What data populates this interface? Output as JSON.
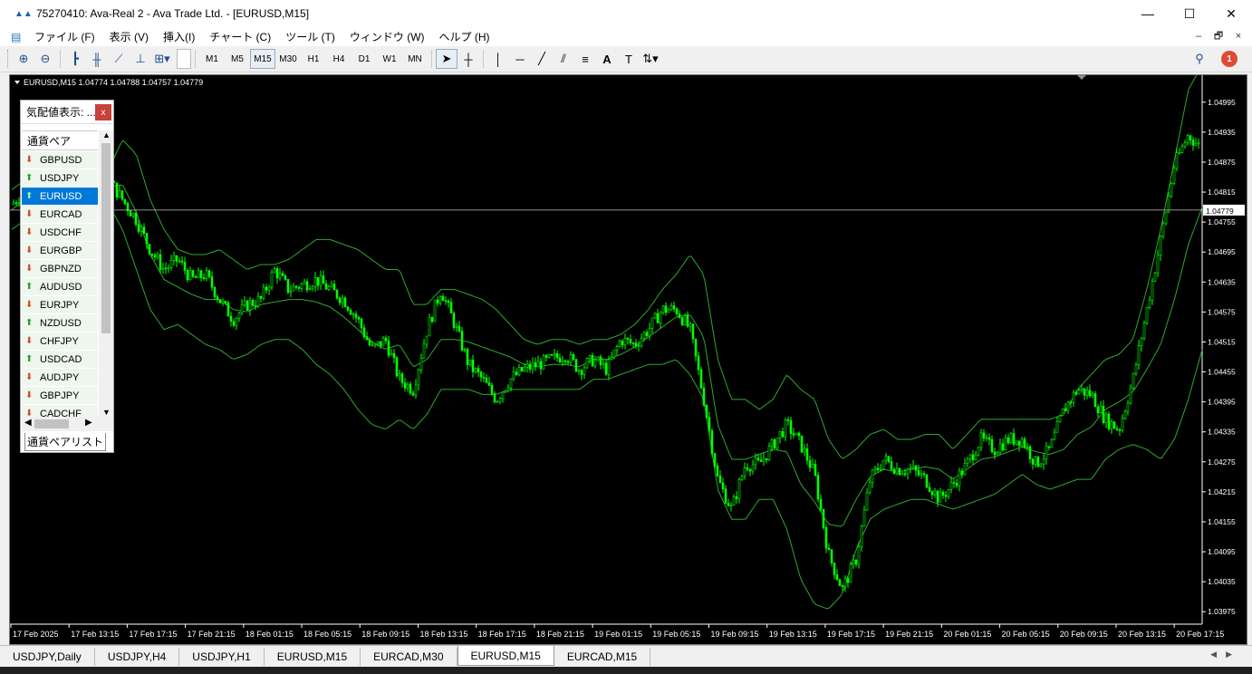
{
  "window": {
    "title": "75270410: Ava-Real 2 - Ava Trade Ltd. - [EURUSD,M15]",
    "minimize": "—",
    "maximize": "☐",
    "close": "✕"
  },
  "menu": [
    "ファイル (F)",
    "表示 (V)",
    "挿入(I)",
    "チャート (C)",
    "ツール (T)",
    "ウィンドウ (W)",
    "ヘルプ (H)"
  ],
  "mdi": {
    "minimize": "–",
    "restore": "🗗",
    "close": "×"
  },
  "timeframes": [
    "M1",
    "M5",
    "M15",
    "M30",
    "H1",
    "H4",
    "D1",
    "W1",
    "MN"
  ],
  "active_timeframe": "M15",
  "notification_count": "1",
  "market_watch": {
    "title": "気配値表示: ...",
    "close": "x",
    "column": "通貨ペア",
    "selected": "EURUSD",
    "rows": [
      {
        "symbol": "GBPUSD",
        "dir": "down"
      },
      {
        "symbol": "USDJPY",
        "dir": "up"
      },
      {
        "symbol": "EURUSD",
        "dir": "up"
      },
      {
        "symbol": "EURCAD",
        "dir": "down"
      },
      {
        "symbol": "USDCHF",
        "dir": "down"
      },
      {
        "symbol": "EURGBP",
        "dir": "down"
      },
      {
        "symbol": "GBPNZD",
        "dir": "down"
      },
      {
        "symbol": "AUDUSD",
        "dir": "up"
      },
      {
        "symbol": "EURJPY",
        "dir": "down"
      },
      {
        "symbol": "NZDUSD",
        "dir": "up"
      },
      {
        "symbol": "CHFJPY",
        "dir": "down"
      },
      {
        "symbol": "USDCAD",
        "dir": "up"
      },
      {
        "symbol": "AUDJPY",
        "dir": "down"
      },
      {
        "symbol": "GBPJPY",
        "dir": "down"
      },
      {
        "symbol": "CADCHF",
        "dir": "down"
      }
    ],
    "tab": "通貨ペアリスト"
  },
  "chart_tabs": [
    "USDJPY,Daily",
    "USDJPY,H4",
    "USDJPY,H1",
    "EURUSD,M15",
    "EURCAD,M30",
    "EURUSD,M15",
    "EURCAD,M15"
  ],
  "active_chart_tab": 5,
  "colors": {
    "candle": "#00ff00",
    "band": "#2fa82f",
    "bg": "#000000",
    "axis": "#ffffff",
    "price_line": "#c0c0c0"
  },
  "chart_data": {
    "type": "candlestick",
    "title": "EURUSD,M15  1.04774 1.04788 1.04757 1.04779",
    "current_price": "1.04779",
    "ylim": [
      1.0395,
      1.0504
    ],
    "y_ticks": [
      "1.04995",
      "1.04935",
      "1.04875",
      "1.04815",
      "1.04755",
      "1.04695",
      "1.04635",
      "1.04575",
      "1.04515",
      "1.04455",
      "1.04395",
      "1.04335",
      "1.04275",
      "1.04215",
      "1.04155",
      "1.04095",
      "1.04035",
      "1.03975"
    ],
    "x_ticks": [
      "17 Feb 2025",
      "17 Feb 13:15",
      "17 Feb 17:15",
      "17 Feb 21:15",
      "18 Feb 01:15",
      "18 Feb 05:15",
      "18 Feb 09:15",
      "18 Feb 13:15",
      "18 Feb 17:15",
      "18 Feb 21:15",
      "19 Feb 01:15",
      "19 Feb 05:15",
      "19 Feb 09:15",
      "19 Feb 13:15",
      "19 Feb 17:15",
      "19 Feb 21:15",
      "20 Feb 01:15",
      "20 Feb 05:15",
      "20 Feb 09:15",
      "20 Feb 13:15",
      "20 Feb 17:15"
    ],
    "close_path": [
      1.0479,
      1.0482,
      1.0484,
      1.0482,
      1.0483,
      1.0484,
      1.0485,
      1.0484,
      1.048,
      1.0476,
      1.047,
      1.0466,
      1.0468,
      1.0464,
      1.0465,
      1.046,
      1.0456,
      1.0459,
      1.046,
      1.0466,
      1.0462,
      1.0463,
      1.0464,
      1.0462,
      1.046,
      1.0456,
      1.045,
      1.0452,
      1.0444,
      1.0442,
      1.0454,
      1.0462,
      1.0455,
      1.0447,
      1.0444,
      1.044,
      1.0444,
      1.0446,
      1.0447,
      1.0448,
      1.0449,
      1.0446,
      1.0448,
      1.0446,
      1.0452,
      1.0451,
      1.0454,
      1.0458,
      1.0458,
      1.0454,
      1.044,
      1.0424,
      1.0418,
      1.0427,
      1.0427,
      1.0431,
      1.0435,
      1.0431,
      1.0425,
      1.0409,
      1.0402,
      1.0408,
      1.0424,
      1.0428,
      1.0426,
      1.0426,
      1.0424,
      1.042,
      1.0423,
      1.0427,
      1.0432,
      1.043,
      1.0432,
      1.0432,
      1.0427,
      1.043,
      1.0438,
      1.0442,
      1.0441,
      1.0436,
      1.0434,
      1.0444,
      1.0458,
      1.0472,
      1.0487,
      1.0493,
      1.049
    ],
    "upper_band": [
      1.0482,
      1.0484,
      1.0486,
      1.0488,
      1.0488,
      1.0488,
      1.0487,
      1.0486,
      1.0492,
      1.0489,
      1.048,
      1.0474,
      1.047,
      1.0469,
      1.0469,
      1.047,
      1.0468,
      1.0466,
      1.0467,
      1.0467,
      1.0468,
      1.047,
      1.0472,
      1.0472,
      1.0471,
      1.047,
      1.0468,
      1.0466,
      1.0466,
      1.0459,
      1.0459,
      1.0462,
      1.0462,
      1.0461,
      1.046,
      1.0458,
      1.0455,
      1.0452,
      1.0451,
      1.0452,
      1.0452,
      1.0451,
      1.0452,
      1.0452,
      1.0453,
      1.0455,
      1.0458,
      1.0462,
      1.0465,
      1.0469,
      1.0465,
      1.0448,
      1.044,
      1.044,
      1.0438,
      1.044,
      1.0445,
      1.0442,
      1.044,
      1.0432,
      1.0428,
      1.043,
      1.0433,
      1.0434,
      1.0432,
      1.0432,
      1.0433,
      1.0433,
      1.043,
      1.0433,
      1.0436,
      1.0436,
      1.0436,
      1.0436,
      1.0436,
      1.0436,
      1.0437,
      1.0442,
      1.0445,
      1.0448,
      1.0449,
      1.0452,
      1.0462,
      1.0474,
      1.0488,
      1.0502,
      1.0507
    ],
    "lower_band": [
      1.0474,
      1.0476,
      1.0478,
      1.0478,
      1.0476,
      1.0476,
      1.0478,
      1.0479,
      1.0474,
      1.0466,
      1.0458,
      1.0454,
      1.0455,
      1.0453,
      1.0451,
      1.045,
      1.0448,
      1.0449,
      1.0451,
      1.0452,
      1.0452,
      1.045,
      1.0447,
      1.0445,
      1.0442,
      1.0438,
      1.0435,
      1.0434,
      1.0436,
      1.0434,
      1.0437,
      1.0442,
      1.0442,
      1.0442,
      1.0441,
      1.0441,
      1.0442,
      1.0442,
      1.0442,
      1.0442,
      1.0442,
      1.0442,
      1.0444,
      1.0444,
      1.0445,
      1.0446,
      1.0447,
      1.0447,
      1.0448,
      1.0445,
      1.044,
      1.0422,
      1.0416,
      1.0416,
      1.042,
      1.042,
      1.0414,
      1.0404,
      1.0399,
      1.0398,
      1.0401,
      1.041,
      1.0416,
      1.0418,
      1.0419,
      1.042,
      1.042,
      1.0419,
      1.0418,
      1.0419,
      1.042,
      1.0421,
      1.0423,
      1.0425,
      1.0423,
      1.0422,
      1.0423,
      1.0424,
      1.0424,
      1.0428,
      1.043,
      1.0431,
      1.043,
      1.0428,
      1.0432,
      1.044,
      1.045
    ]
  }
}
